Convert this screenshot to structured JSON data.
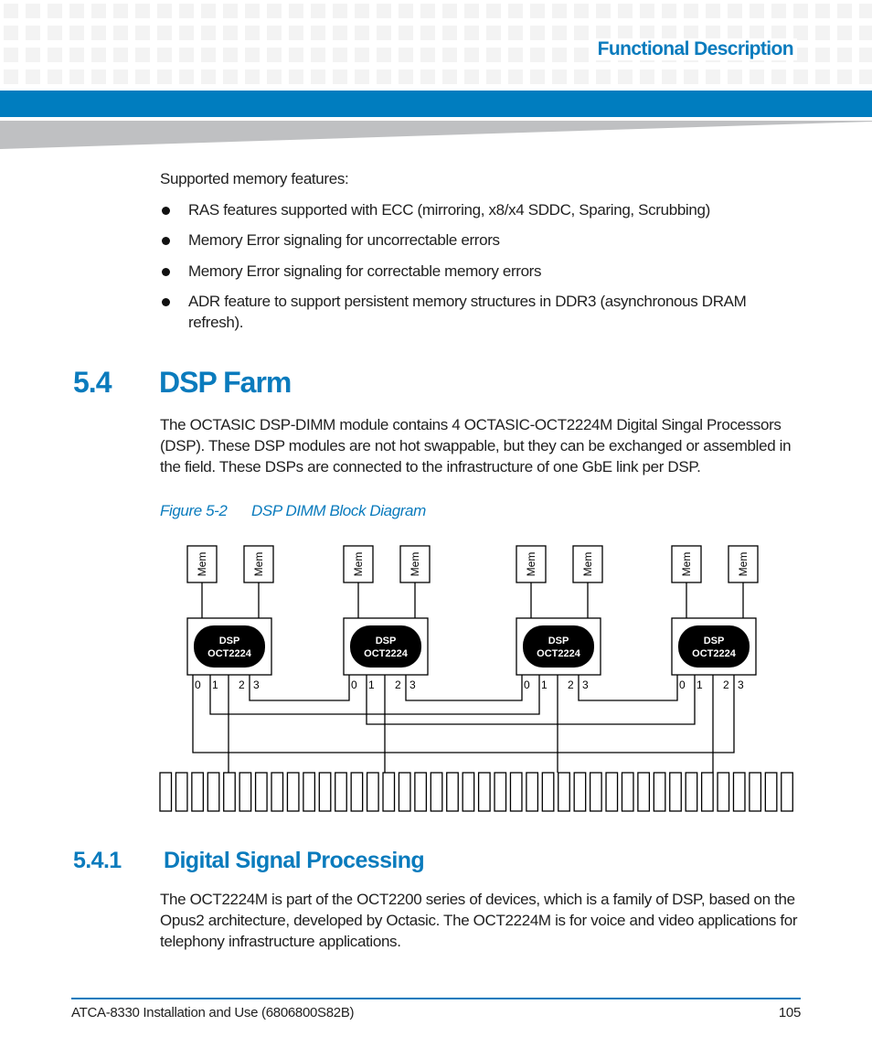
{
  "header": {
    "section_title": "Functional Description",
    "colors": {
      "accent": "#007dbf",
      "pattern": "#f3f3f3",
      "wedge": "#bfc0c2"
    }
  },
  "intro": {
    "lead": "Supported memory features:",
    "bullets": [
      "RAS features supported with ECC (mirroring, x8/x4 SDDC, Sparing, Scrubbing)",
      "Memory Error signaling for uncorrectable errors",
      "Memory Error signaling for correctable memory errors",
      "ADR feature to support persistent memory structures in DDR3 (asynchronous DRAM refresh)."
    ]
  },
  "section_5_4": {
    "number": "5.4",
    "title": "DSP Farm",
    "paragraph": "The OCTASIC DSP-DIMM module contains 4 OCTASIC-OCT2224M Digital Singal Processors (DSP). These DSP modules are not hot swappable, but they can be exchanged or assembled in the field. These DSPs are connected to the infrastructure of one GbE link per DSP."
  },
  "figure": {
    "label": "Figure 5-2",
    "caption": "DSP DIMM Block Diagram",
    "mem_label": "Mem",
    "dsp_label_line1": "DSP",
    "dsp_label_line2": "OCT2224",
    "dsp_count": 4,
    "port_labels": [
      "0",
      "1",
      "2",
      "3"
    ],
    "connector_count": 40,
    "links": [
      {
        "from": "DSP1.port3",
        "to": "DSP2.port0"
      },
      {
        "from": "DSP2.port3",
        "to": "DSP3.port0"
      },
      {
        "from": "DSP3.port3",
        "to": "DSP4.port0"
      },
      {
        "from": "DSP1.port1",
        "to": "DSP3.port1"
      },
      {
        "from": "DSP2.port1",
        "to": "DSP4.port1"
      },
      {
        "from": "DSP1.port0",
        "to": "DSP4.port3"
      },
      {
        "from": "DSP1.port2",
        "to": "connector"
      },
      {
        "from": "DSP2.port2",
        "to": "connector"
      },
      {
        "from": "DSP3.port2",
        "to": "connector"
      },
      {
        "from": "DSP4.port2",
        "to": "connector"
      }
    ]
  },
  "section_5_4_1": {
    "number": "5.4.1",
    "title": "Digital Signal Processing",
    "paragraph": "The OCT2224M is part of the OCT2200 series of devices, which is a family of DSP, based on the Opus2 architecture, developed by Octasic. The OCT2224M is for voice and video applications for telephony infrastructure applications."
  },
  "footer": {
    "doc_title": "ATCA-8330 Installation and Use (6806800S82B)",
    "page_number": "105"
  }
}
